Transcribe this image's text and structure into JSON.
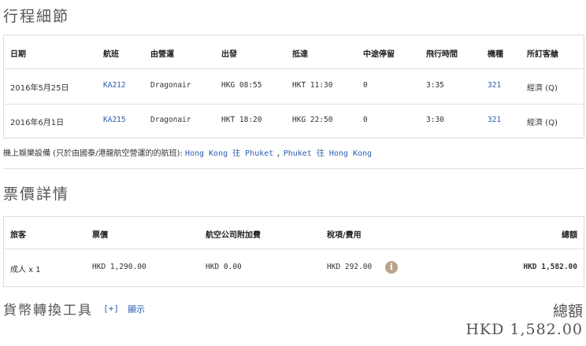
{
  "itinerary": {
    "title": "行程細節",
    "headers": {
      "date": "日期",
      "flight": "航班",
      "operator": "由營運",
      "departure": "出發",
      "arrival": "抵達",
      "stops": "中途停留",
      "duration": "飛行時間",
      "aircraft": "機種",
      "cabin": "所訂客艙"
    },
    "rows": [
      {
        "date": "2016年5月25日",
        "flight": "KA212",
        "operator": "Dragonair",
        "departure": "HKG 08:55",
        "arrival": "HKT 11:30",
        "stops": "0",
        "duration": "3:35",
        "aircraft": "321",
        "cabin": "經濟 (Q)"
      },
      {
        "date": "2016年6月1日",
        "flight": "KA215",
        "operator": "Dragonair",
        "departure": "HKT 18:20",
        "arrival": "HKG 22:50",
        "stops": "0",
        "duration": "3:30",
        "aircraft": "321",
        "cabin": "經濟 (Q)"
      }
    ]
  },
  "entertainment": {
    "prefix": "機上娛樂設備 (只於由國泰/港龍航空營運的的航班):",
    "link1": "Hong Kong 往 Phuket",
    "separator": ",",
    "link2": "Phuket 往 Hong Kong"
  },
  "fare": {
    "title": "票價詳情",
    "headers": {
      "passenger": "旅客",
      "fare": "票價",
      "surcharge": "航空公司附加費",
      "taxes": "稅項/費用",
      "total": "總額"
    },
    "row": {
      "passenger": "成人 x 1",
      "fare": "HKD 1,290.00",
      "surcharge": "HKD 0.00",
      "taxes": "HKD 292.00",
      "total": "HKD 1,582.00"
    },
    "info_icon": "info-icon"
  },
  "converter": {
    "title": "貨幣轉換工具",
    "toggle": "[+]",
    "show": "顯示"
  },
  "summary": {
    "total_label": "總額",
    "total_amount": "HKD 1,582.00"
  },
  "colors": {
    "link": "#2a5db0",
    "border": "#dcdcdc",
    "info_icon": "#b9a48a"
  }
}
